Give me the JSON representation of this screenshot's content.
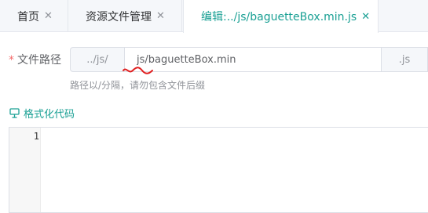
{
  "tabs": [
    {
      "label": "首页",
      "close": "✕"
    },
    {
      "label": "资源文件管理",
      "close": "✕"
    },
    {
      "label": "编辑:../js/baguetteBox.min.js",
      "close": "✕"
    }
  ],
  "form": {
    "required_mark": "*",
    "label": "文件路径",
    "prefix": "../js/",
    "value": "js/baguetteBox.min",
    "suffix": ".js",
    "hint": "路径以/分隔，请勿包含文件后缀"
  },
  "format_button": {
    "label": "格式化代码",
    "icon": "format-icon"
  },
  "editor": {
    "line_numbers": [
      "1"
    ]
  },
  "colors": {
    "accent": "#1aa094",
    "required": "#f56c6c",
    "annotation": "#e02020"
  }
}
